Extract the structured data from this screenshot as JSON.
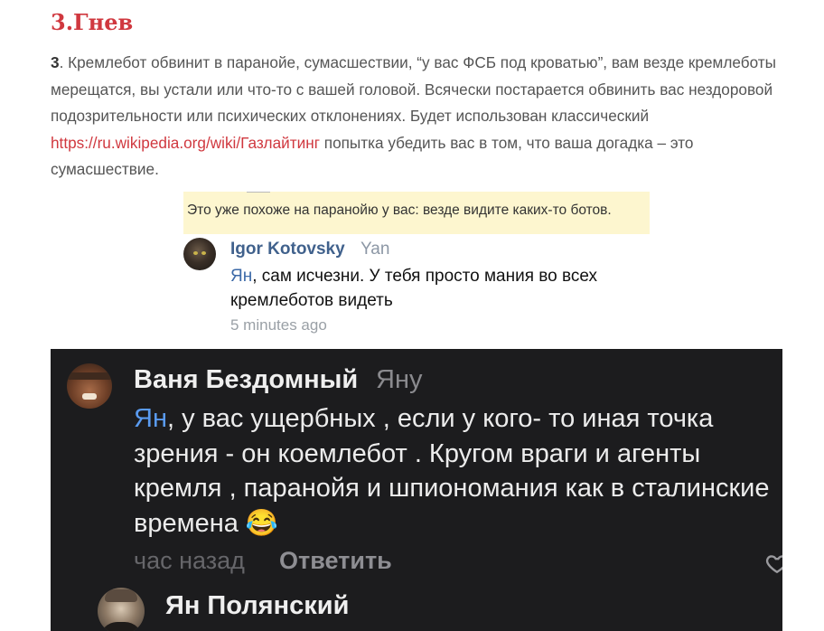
{
  "article": {
    "heading": "3.Гнев",
    "para_num": "3",
    "para_before": ". Кремлебот обвинит в паранойе, сумасшествии, “у вас ФСБ под кроватью”, вам везде кремлеботы мерещатся, вы устали или что-то с вашей головой. Всячески постарается обвинить вас нездоровой подозрительности или психических отклонениях. Будет использован классический ",
    "para_link": "https://ru.wikipedia.org/wiki/Газлайтинг",
    "para_after": " попытка убедить вас в том, что ваша догадка – это сумасшествие."
  },
  "screenshot1": {
    "quoted_text": "Это уже похоже на паранойю у вас: везде видите каких-то ботов.",
    "author": "Igor Kotovsky",
    "reply_to": "Yan",
    "mention": "Ян",
    "text": ", сам исчезни. У тебя просто мания во всех кремлеботов видеть",
    "time": "5 minutes ago",
    "colors": {
      "highlight": "#fdf6cf",
      "name": "#40618c",
      "mention": "#3d6aa8"
    }
  },
  "screenshot2": {
    "author": "Ваня Бездомный",
    "reply_to": "Яну",
    "mention": "Ян",
    "text": ", у вас ущербных , если у кого- то иная точка зрения - он коемлебот . Кругом враги и агенты кремля , паранойя  и шпиономания как в сталинские времена 😂",
    "time": "час назад",
    "reply_label": "Ответить",
    "next_author": "Ян Полянский",
    "icons": [
      "avatar",
      "heart-icon"
    ],
    "colors": {
      "background": "#1c1c1e",
      "mention": "#5a9bf0"
    }
  }
}
